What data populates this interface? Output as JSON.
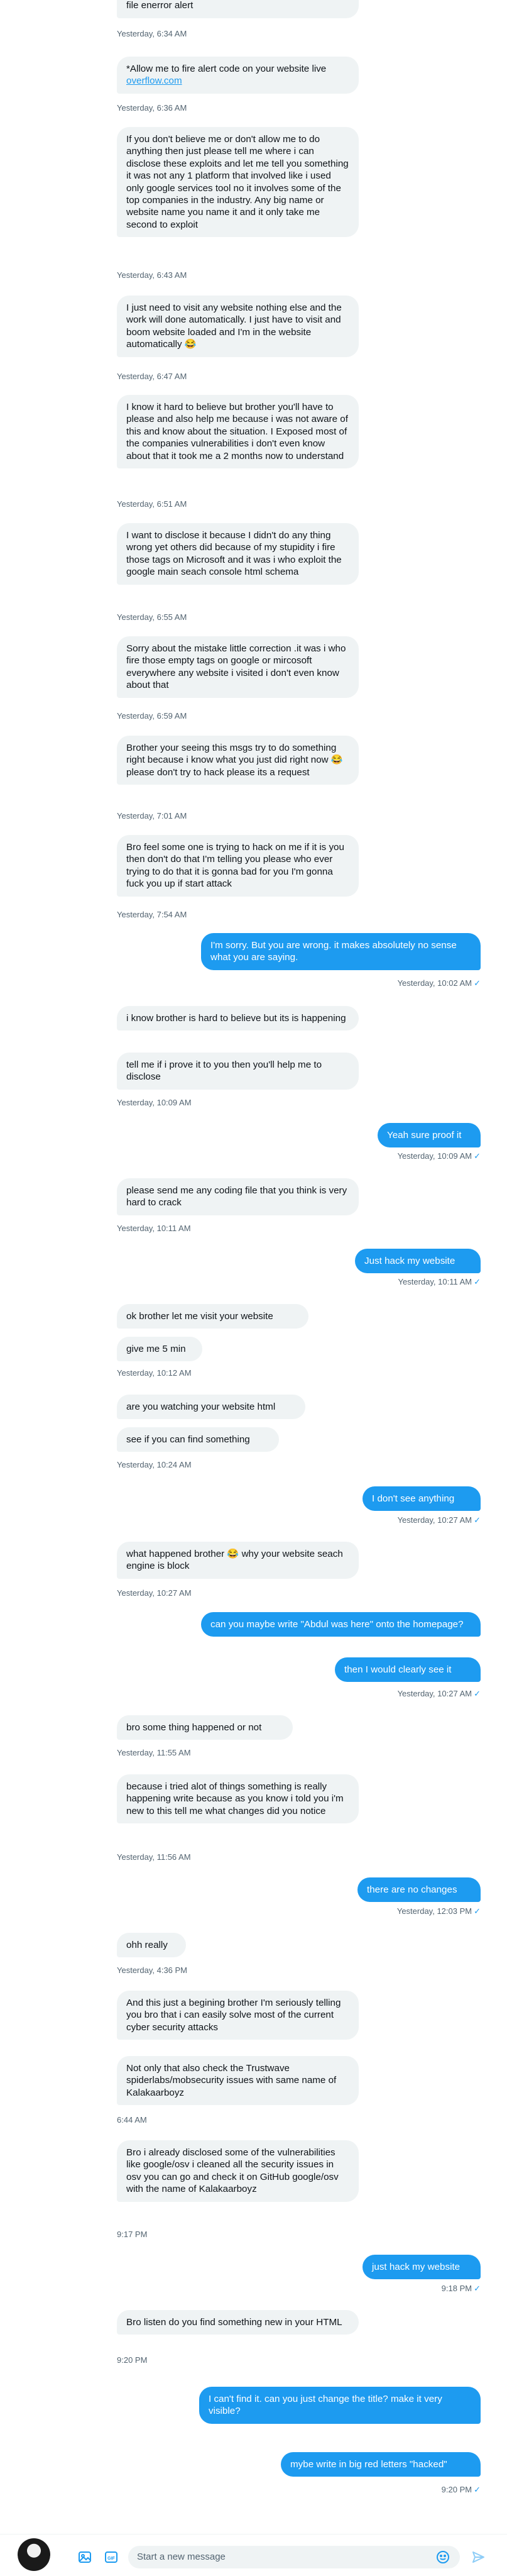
{
  "conversation": {
    "messages": [
      {
        "dir": "in",
        "text": "brother let me visit your websites and allow me to file enerror alert",
        "time": "Yesterday, 6:34 AM"
      },
      {
        "dir": "in",
        "text": "*Allow me to fire alert code on your website live ",
        "link": "overflow.com",
        "time": "Yesterday, 6:36 AM"
      },
      {
        "dir": "in",
        "text": "If you don't believe me or don't allow me to do anything then just please tell me where i can disclose these exploits and let me tell you something it was not any 1 platform that involved like i used only google services tool no it involves some of the top companies in the industry. Any big name or website name you name it and it only take me second to exploit",
        "time": "Yesterday, 6:43 AM"
      },
      {
        "dir": "in",
        "text": "I just need to visit any website nothing else and the work will done automatically. I just have to visit and boom website loaded and I'm in the website automatically 😂",
        "time": "Yesterday, 6:47 AM"
      },
      {
        "dir": "in",
        "text": "I know it hard to believe but brother you'll have to please and also help me because i was not aware of this and know about the situation. I Exposed most of the companies vulnerabilities i don't even know about that it took me a 2 months now to understand",
        "time": "Yesterday, 6:51 AM"
      },
      {
        "dir": "in",
        "text": "I want to disclose it because I didn't do any thing wrong yet others did because of my stupidity i fire those tags on Microsoft and it was i who exploit the google main seach console html schema",
        "time": "Yesterday, 6:55 AM"
      },
      {
        "dir": "in",
        "text": "Sorry about the mistake little correction .it was i who fire those empty tags  on google or mircosoft everywhere any website i visited i don't even know about that",
        "time": "Yesterday, 6:59 AM"
      },
      {
        "dir": "in",
        "text": "Brother your seeing this msgs try to do something right because i know what you just did right now 😂 please don't try to hack please its a request",
        "time": "Yesterday, 7:01 AM"
      },
      {
        "dir": "in",
        "text": "Bro feel some one is trying to hack on me if it is you then don't do that I'm telling you please who ever trying to do that it is gonna bad for you I'm gonna fuck you up if start attack",
        "time": "Yesterday, 7:54 AM"
      },
      {
        "dir": "out",
        "text": "I'm sorry. But you are wrong. it makes absolutely no sense what you are saying.",
        "time": "Yesterday, 10:02 AM"
      },
      {
        "dir": "in",
        "text": "i know brother is hard to believe but its is happening",
        "time": ""
      },
      {
        "dir": "in",
        "text": "tell me if i prove it to you then you'll help me to disclose",
        "time": "Yesterday, 10:09 AM"
      },
      {
        "dir": "out",
        "text": "Yeah sure proof it",
        "time": "Yesterday, 10:09 AM"
      },
      {
        "dir": "in",
        "text": "please send me any coding file that you think is very hard to crack",
        "time": "Yesterday, 10:11 AM"
      },
      {
        "dir": "out",
        "text": "Just hack my website",
        "time": "Yesterday, 10:11 AM"
      },
      {
        "dir": "in",
        "text": "ok brother let me visit your website",
        "time": ""
      },
      {
        "dir": "in",
        "text": "give me 5 min",
        "time": "Yesterday, 10:12 AM"
      },
      {
        "dir": "in",
        "text": "are you watching your website html",
        "time": ""
      },
      {
        "dir": "in",
        "text": "see if you can find something",
        "time": "Yesterday, 10:24 AM"
      },
      {
        "dir": "out",
        "text": "I don't see anything",
        "time": "Yesterday, 10:27 AM"
      },
      {
        "dir": "in",
        "text": "what happened brother 😂 why your website seach engine is block",
        "time": "Yesterday, 10:27 AM"
      },
      {
        "dir": "out",
        "text": "can you maybe write \"Abdul was here\" onto the homepage?",
        "time": ""
      },
      {
        "dir": "out",
        "text": "then I would clearly see it",
        "time": "Yesterday, 10:27 AM"
      },
      {
        "dir": "in",
        "text": "bro some thing happened or not",
        "time": "Yesterday, 11:55 AM"
      },
      {
        "dir": "in",
        "text": "because i tried alot of things something is really happening write because as you know i told you i'm new to this tell me what changes did you notice",
        "time": "Yesterday, 11:56 AM"
      },
      {
        "dir": "out",
        "text": "there are no changes",
        "time": "Yesterday, 12:03 PM"
      },
      {
        "dir": "in",
        "text": "ohh really",
        "time": "Yesterday, 4:36 PM"
      },
      {
        "dir": "in",
        "text": "And this just a begining brother I'm seriously telling you bro that i can easily solve most of the current cyber security attacks",
        "time": ""
      },
      {
        "dir": "in",
        "text": "Not only that also check the Trustwave spiderlabs/mobsecurity issues with same name of Kalakaarboyz",
        "time": "6:44 AM"
      },
      {
        "dir": "in",
        "text": "Bro i already disclosed some of the vulnerabilities like google/osv i cleaned all the security issues in osv you can go and check it on GitHub google/osv with the name of Kalakaarboyz",
        "time": "9:17 PM"
      },
      {
        "dir": "out",
        "text": "just hack my website",
        "time": "9:18 PM"
      },
      {
        "dir": "in",
        "text": "Bro listen do you find something new in your HTML",
        "time": "9:20 PM"
      },
      {
        "dir": "out",
        "text": "I can't find it. can you just change the title? make it very visible?",
        "time": ""
      },
      {
        "dir": "out",
        "text": "mybe write in big red letters \"hacked\"",
        "time": "9:20 PM"
      }
    ]
  },
  "composer": {
    "placeholder": "Start a new message",
    "icons": [
      "avatar",
      "image-icon",
      "gif-icon",
      "emoji-icon",
      "send-icon"
    ]
  },
  "colors": {
    "accent": "#1d9bf0",
    "incoming_bg": "#eff3f4",
    "timestamp": "#536471"
  }
}
